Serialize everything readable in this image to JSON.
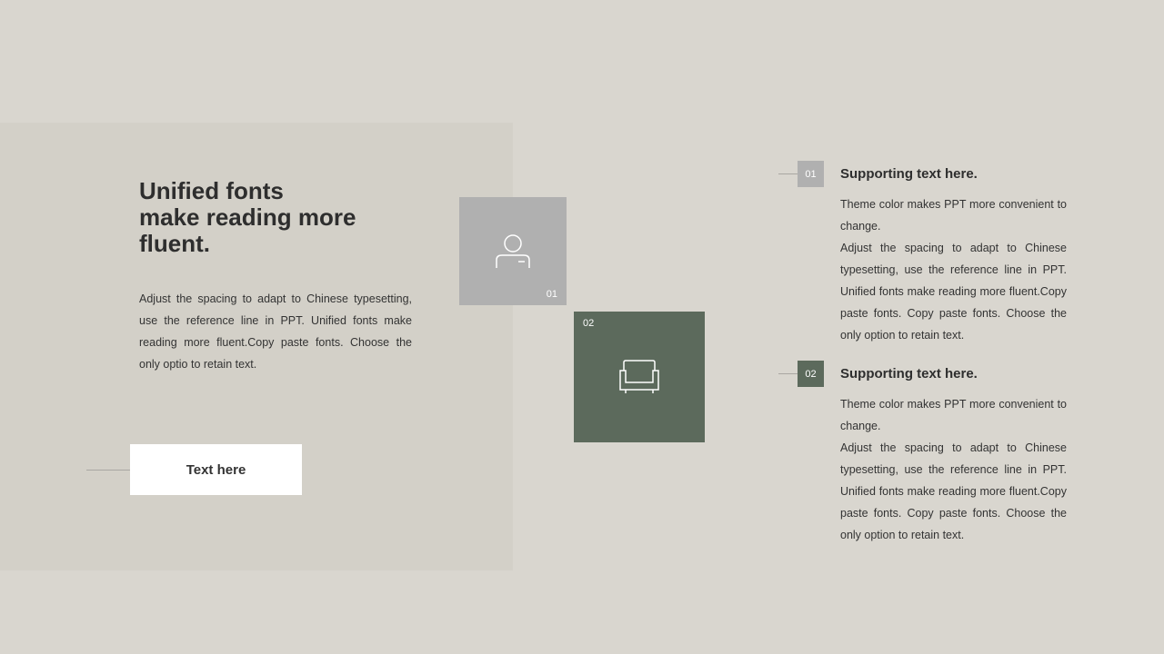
{
  "left": {
    "headline": "Unified fonts\nmake reading more\nfluent.",
    "body": "Adjust the spacing to adapt to Chinese typesetting, use the reference line in PPT. Unified fonts make reading more fluent.Copy paste fonts. Choose the only optio to retain text.",
    "button_label": "Text here"
  },
  "tiles": [
    {
      "number": "01",
      "icon": "user-icon",
      "color": "#b0b0b0"
    },
    {
      "number": "02",
      "icon": "armchair-icon",
      "color": "#5c6a5c"
    }
  ],
  "items": [
    {
      "number": "01",
      "title": "Supporting text here.",
      "text": "Theme  color makes PPT more convenient to change.\nAdjust the spacing to adapt to Chinese typesetting, use the reference line in PPT. Unified  fonts make reading more fluent.Copy paste fonts. Copy paste  fonts. Choose the only option to retain text."
    },
    {
      "number": "02",
      "title": "Supporting text here.",
      "text": "Theme  color makes PPT more convenient to change.\nAdjust the spacing to adapt to Chinese typesetting, use the reference line in PPT. Unified  fonts make reading more fluent.Copy paste fonts. Copy paste  fonts. Choose the only option to retain text."
    }
  ],
  "colors": {
    "background": "#d9d6cf",
    "panel": "#d3d0c8",
    "gray_accent": "#b0b0b0",
    "green_accent": "#5c6a5c"
  }
}
